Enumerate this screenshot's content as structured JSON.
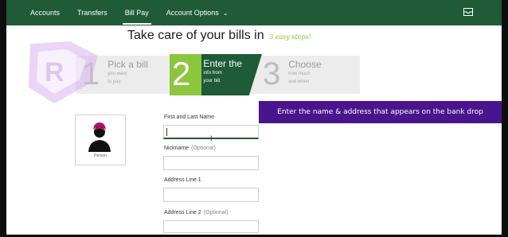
{
  "nav": {
    "items": [
      {
        "label": "Accounts"
      },
      {
        "label": "Transfers"
      },
      {
        "label": "Bill Pay",
        "active": true
      },
      {
        "label": "Account Options",
        "dropdown": true
      }
    ],
    "mail_icon": "mail-icon"
  },
  "heading": {
    "text": "Take care of your bills in",
    "accent": "3 easy steps!"
  },
  "steps": [
    {
      "number": "1",
      "title": "Pick a bill",
      "sub1": "you want",
      "sub2": "to pay."
    },
    {
      "number": "2",
      "title": "Enter the",
      "sub1": "info from",
      "sub2": "your bill.",
      "active": true
    },
    {
      "number": "3",
      "title": "Choose",
      "sub1": "how much",
      "sub2": "and when"
    }
  ],
  "banner": {
    "text": "Enter the name & address that appears on the bank drop"
  },
  "person": {
    "label": "Person",
    "icon": "person-icon"
  },
  "form": {
    "first_last": {
      "label": "First and Last Name",
      "value": ""
    },
    "nickname": {
      "label": "Nickname",
      "optional": "(Optional)",
      "value": ""
    },
    "address1": {
      "label": "Address Line 1",
      "value": ""
    },
    "address2": {
      "label": "Address Line 2",
      "optional": "(Optional)",
      "value": ""
    }
  },
  "colors": {
    "nav_green": "#1e5b36",
    "step_accent": "#8cc63f",
    "banner_purple": "#4a148c"
  }
}
